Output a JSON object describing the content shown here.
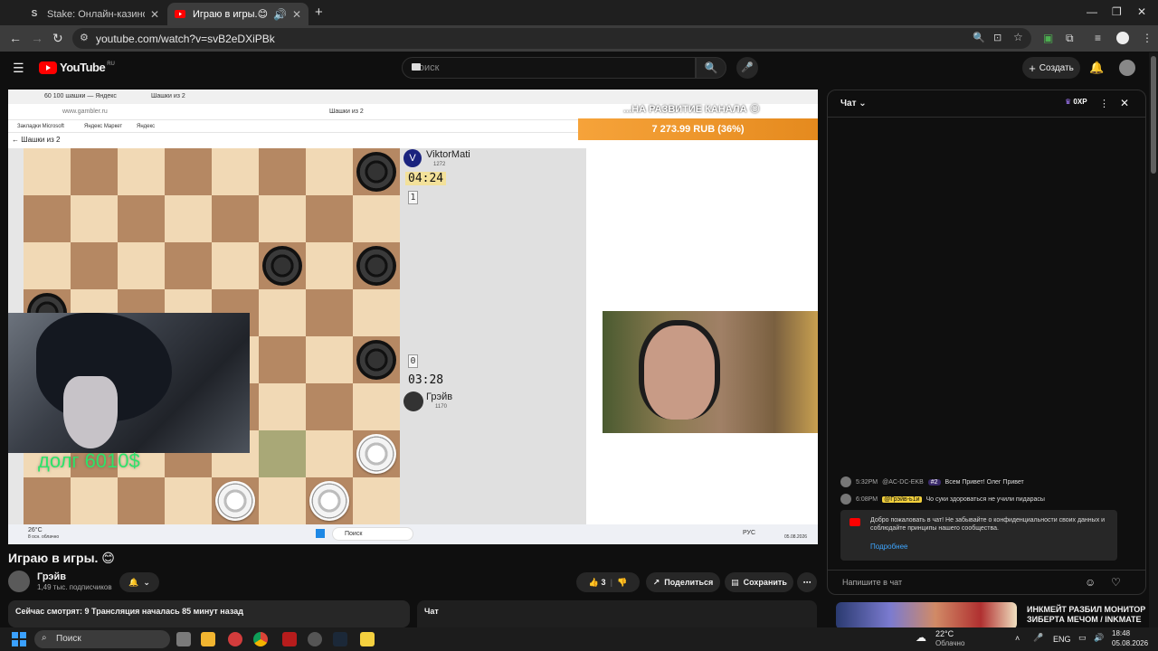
{
  "browser": {
    "tabs": [
      {
        "title": "Stake: Онлайн-казино и ставк",
        "active": false
      },
      {
        "title": "Играю в игры.😊 - YouTu",
        "active": true
      }
    ],
    "url": "youtube.com/watch?v=svB2eDXiPBk"
  },
  "youtube": {
    "logo": "YouTube",
    "logo_region": "RU",
    "search_placeholder": "Поиск",
    "create_label": "Создать"
  },
  "stream": {
    "inner_tab": "60 100 шашки — Яндекс",
    "inner_tab2": "Шашки из 2",
    "inner_url": "www.gambler.ru",
    "inner_page_title": "Шашки из 2",
    "bookmarks": [
      "Закладки Microsoft",
      "Яндекс Маркет",
      "Яндекс"
    ],
    "back_label": "Шашки из 2",
    "player_top": {
      "name": "ViktorMati",
      "rating": "1272",
      "timer": "04:24",
      "score": "1"
    },
    "player_bottom": {
      "name": "Грэйв",
      "rating": "1170",
      "timer": "03:28",
      "score": "0"
    },
    "overlay_debt": "долг 6010$",
    "donation_title": "...НА РАЗВИТИЕ КАНАЛА 😊",
    "donation_amount": "7 273.99 RUB (36%)",
    "inner_weather": "26°C",
    "inner_weather_sub": "8 осн. облачно",
    "inner_search": "Поиск",
    "inner_date": "05.08.2026",
    "inner_lang": "РУС"
  },
  "video": {
    "title": "Играю в игры. 😊",
    "channel": "Грэйв",
    "subscribers": "1,49 тыс. подписчиков",
    "likes": "3",
    "share_label": "Поделиться",
    "save_label": "Сохранить",
    "desc_line1": "Сейчас смотрят: 9  Трансляция началась 85 минут назад",
    "chat_mini_label": "Чат"
  },
  "chat": {
    "title": "Чат",
    "xp": "0XP",
    "messages": [
      {
        "time": "5:32PM",
        "author": "@AC-DC-EKB",
        "badge": "#2",
        "text": "Всем Привет! Олег Привет"
      },
      {
        "time": "6:08PM",
        "author": "@Грэйв-ь1и",
        "badge": "",
        "text": "Чо суки здороваться не учили пидарасы"
      }
    ],
    "welcome_text": "Добро пожаловать в чат! Не забывайте о конфиденциальности своих данных и соблюдайте принципы нашего сообщества.",
    "welcome_more": "Подробнее",
    "input_placeholder": "Напишите в чат"
  },
  "recommendation": {
    "title": "ИНКМЕЙТ РАЗБИЛ МОНИТОР ЗИБЕРТА МЕЧОМ / INKMATE"
  },
  "taskbar": {
    "search": "Поиск",
    "temperature": "22°C",
    "weather": "Облачно",
    "lang": "ENG",
    "time": "18:48",
    "date": "05.08.2026"
  },
  "colors": {
    "accent_red": "#ff0000",
    "donation_orange": "#f6a33a",
    "debt_green": "#2ee36a",
    "board_light": "#f1d9b5",
    "board_dark": "#b58863"
  }
}
